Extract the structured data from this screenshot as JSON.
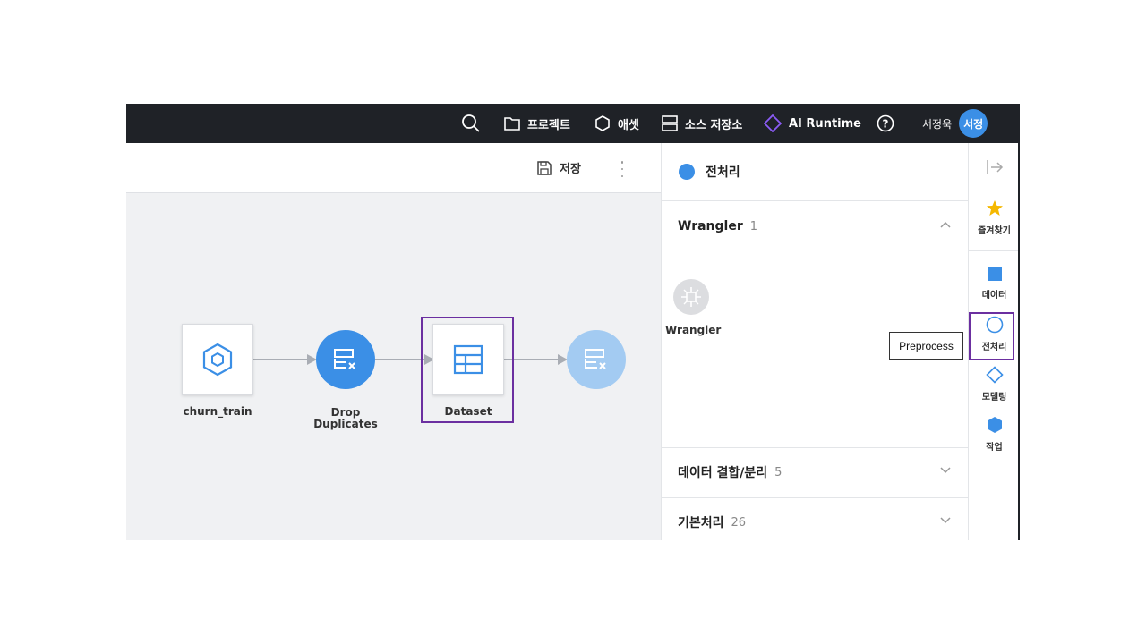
{
  "topbar": {
    "search_icon": "search-icon",
    "project_label": "프로젝트",
    "asset_label": "애셋",
    "source_label": "소스 저장소",
    "runtime_label": "AI Runtime",
    "help_icon": "help-icon",
    "user_name": "서정욱",
    "avatar_text": "서정",
    "runtime_color": "#8b5cf6"
  },
  "toolbar": {
    "save_label": "저장"
  },
  "pipeline": {
    "nodes": [
      {
        "label": "churn_train",
        "kind": "hexagon-icon"
      },
      {
        "label": "Drop\nDuplicates",
        "kind": "drop-duplicates-icon"
      },
      {
        "label": "Dataset",
        "kind": "table-icon"
      },
      {
        "label": "",
        "kind": "drop-duplicates-icon"
      }
    ]
  },
  "panel": {
    "title": "전처리",
    "sections": [
      {
        "title": "Wrangler",
        "count": "1",
        "expanded": true
      },
      {
        "title": "데이터 결합/분리",
        "count": "5",
        "expanded": false
      },
      {
        "title": "기본처리",
        "count": "26",
        "expanded": false
      }
    ],
    "wrangler_item": "Wrangler"
  },
  "rail": {
    "favorites": "즐겨찾기",
    "data": "데이터",
    "preprocess": "전처리",
    "modeling": "모델링",
    "job": "작업"
  },
  "tooltip": {
    "text": "Preprocess"
  },
  "colors": {
    "accent": "#3b8fe6",
    "highlight": "#6b2fa0",
    "star": "#f5b800"
  }
}
